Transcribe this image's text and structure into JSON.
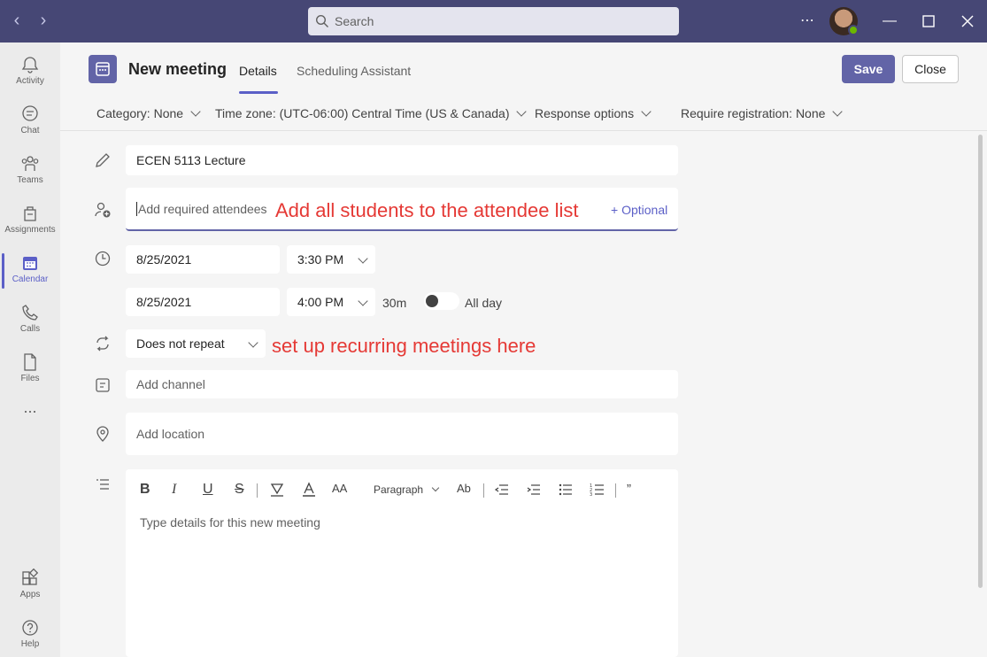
{
  "titlebar": {
    "search_placeholder": "Search",
    "more_icon": "ellipsis-icon",
    "user": "avatar"
  },
  "rail": {
    "items": [
      {
        "label": "Activity",
        "icon": "bell-icon"
      },
      {
        "label": "Chat",
        "icon": "chat-icon"
      },
      {
        "label": "Teams",
        "icon": "teams-icon"
      },
      {
        "label": "Assignments",
        "icon": "assignments-icon"
      },
      {
        "label": "Calendar",
        "icon": "calendar-icon",
        "active": true
      },
      {
        "label": "Calls",
        "icon": "phone-icon"
      },
      {
        "label": "Files",
        "icon": "file-icon"
      },
      {
        "label": "Apps",
        "icon": "apps-icon"
      },
      {
        "label": "Help",
        "icon": "help-icon"
      }
    ],
    "more": "..."
  },
  "header": {
    "title": "New meeting",
    "tabs": [
      {
        "label": "Details",
        "active": true
      },
      {
        "label": "Scheduling Assistant"
      }
    ],
    "save_label": "Save",
    "close_label": "Close"
  },
  "options": {
    "category": "Category: None",
    "timezone": "Time zone: (UTC-06:00) Central Time (US & Canada)",
    "response": "Response options",
    "registration": "Require registration: None"
  },
  "form": {
    "title_value": "ECEN 5113 Lecture",
    "attendees_placeholder": "Add required attendees",
    "optional_label": "+ Optional",
    "start_date": "8/25/2021",
    "start_time": "3:30 PM",
    "end_date": "8/25/2021",
    "end_time": "4:00 PM",
    "duration": "30m",
    "all_day_label": "All day",
    "repeat_value": "Does not repeat",
    "channel_placeholder": "Add channel",
    "location_placeholder": "Add location"
  },
  "annotations": {
    "attendees_note": "Add all students to the attendee list",
    "repeat_note": "set up recurring meetings here"
  },
  "editor": {
    "paragraph_label": "Paragraph",
    "placeholder": "Type details for this new meeting"
  },
  "colors": {
    "titlebar": "#464775",
    "accent": "#6264a7",
    "annotation": "#e53935"
  }
}
